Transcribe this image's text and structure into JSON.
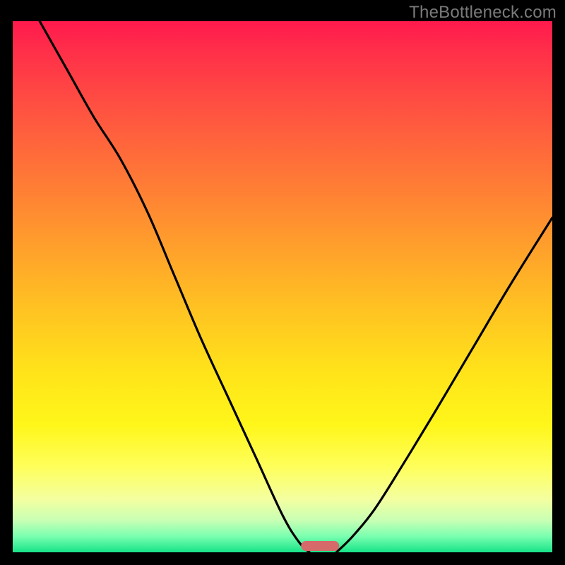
{
  "attribution": "TheBottleneck.com",
  "colors": {
    "background": "#000000",
    "gradient_top": "#ff1a4d",
    "gradient_bottom": "#17e388",
    "curve": "#000000",
    "marker": "#d66a6a",
    "attribution_text": "#7a7a7a"
  },
  "chart_data": {
    "type": "line",
    "title": "",
    "xlabel": "",
    "ylabel": "",
    "xlim": [
      0,
      100
    ],
    "ylim": [
      0,
      100
    ],
    "grid": false,
    "legend": false,
    "series": [
      {
        "name": "bottleneck-curve-left",
        "x": [
          5,
          10,
          15,
          20,
          25,
          30,
          35,
          40,
          45,
          50,
          53,
          55
        ],
        "values": [
          100,
          91,
          82,
          74,
          64,
          52,
          40,
          29,
          18,
          7,
          2,
          0
        ]
      },
      {
        "name": "bottleneck-curve-right",
        "x": [
          60,
          63,
          67,
          72,
          78,
          85,
          92,
          100
        ],
        "values": [
          0,
          3,
          8,
          16,
          26,
          38,
          50,
          63
        ]
      }
    ],
    "marker": {
      "name": "optimal-zone",
      "x_center": 57,
      "width_pct": 7
    }
  }
}
